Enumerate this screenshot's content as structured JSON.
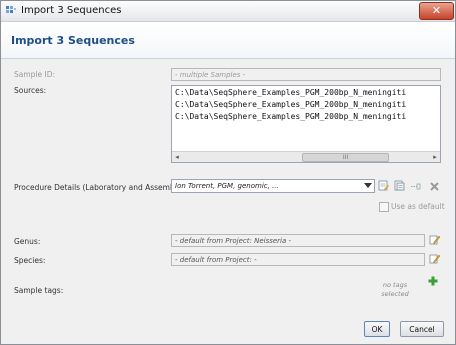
{
  "window": {
    "title": "Import 3 Sequences"
  },
  "header": {
    "title": "Import 3 Sequences"
  },
  "form": {
    "sample_id": {
      "label": "Sample ID:",
      "value": "- multiple Samples -"
    },
    "sources": {
      "label": "Sources:",
      "lines": [
        "C:\\Data\\SeqSphere_Examples_PGM_200bp_N_meningiti",
        "C:\\Data\\SeqSphere_Examples_PGM_200bp_N_meningiti",
        "C:\\Data\\SeqSphere_Examples_PGM_200bp_N_meningiti"
      ],
      "scroll_left": "◂",
      "scroll_right": "▸",
      "scroll_thumb": "III"
    },
    "procedure": {
      "label": "Procedure Details (Laboratory and Assembly):",
      "value": "Ion Torrent, PGM, genomic, ..."
    },
    "use_as_default": {
      "label": "Use as default"
    },
    "genus": {
      "label": "Genus:",
      "value": "- default from Project: Neisseria -"
    },
    "species": {
      "label": "Species:",
      "value": "- default from Project:  -"
    },
    "sample_tags": {
      "label": "Sample tags:",
      "empty_text": "no tags selected"
    }
  },
  "buttons": {
    "ok": "OK",
    "cancel": "Cancel"
  },
  "icons": {
    "app": "app-grid-icon",
    "close": "close-icon",
    "procedure_edit": "edit-document-icon",
    "procedure_new": "new-document-icon",
    "procedure_link": "link-icon",
    "procedure_delete": "delete-x-icon",
    "genus_edit": "pencil-edit-icon",
    "species_edit": "pencil-edit-icon",
    "tags_add": "plus-icon"
  },
  "colors": {
    "accent": "#1d4f84",
    "close": "#c7432b",
    "plus": "#3aa03a"
  }
}
